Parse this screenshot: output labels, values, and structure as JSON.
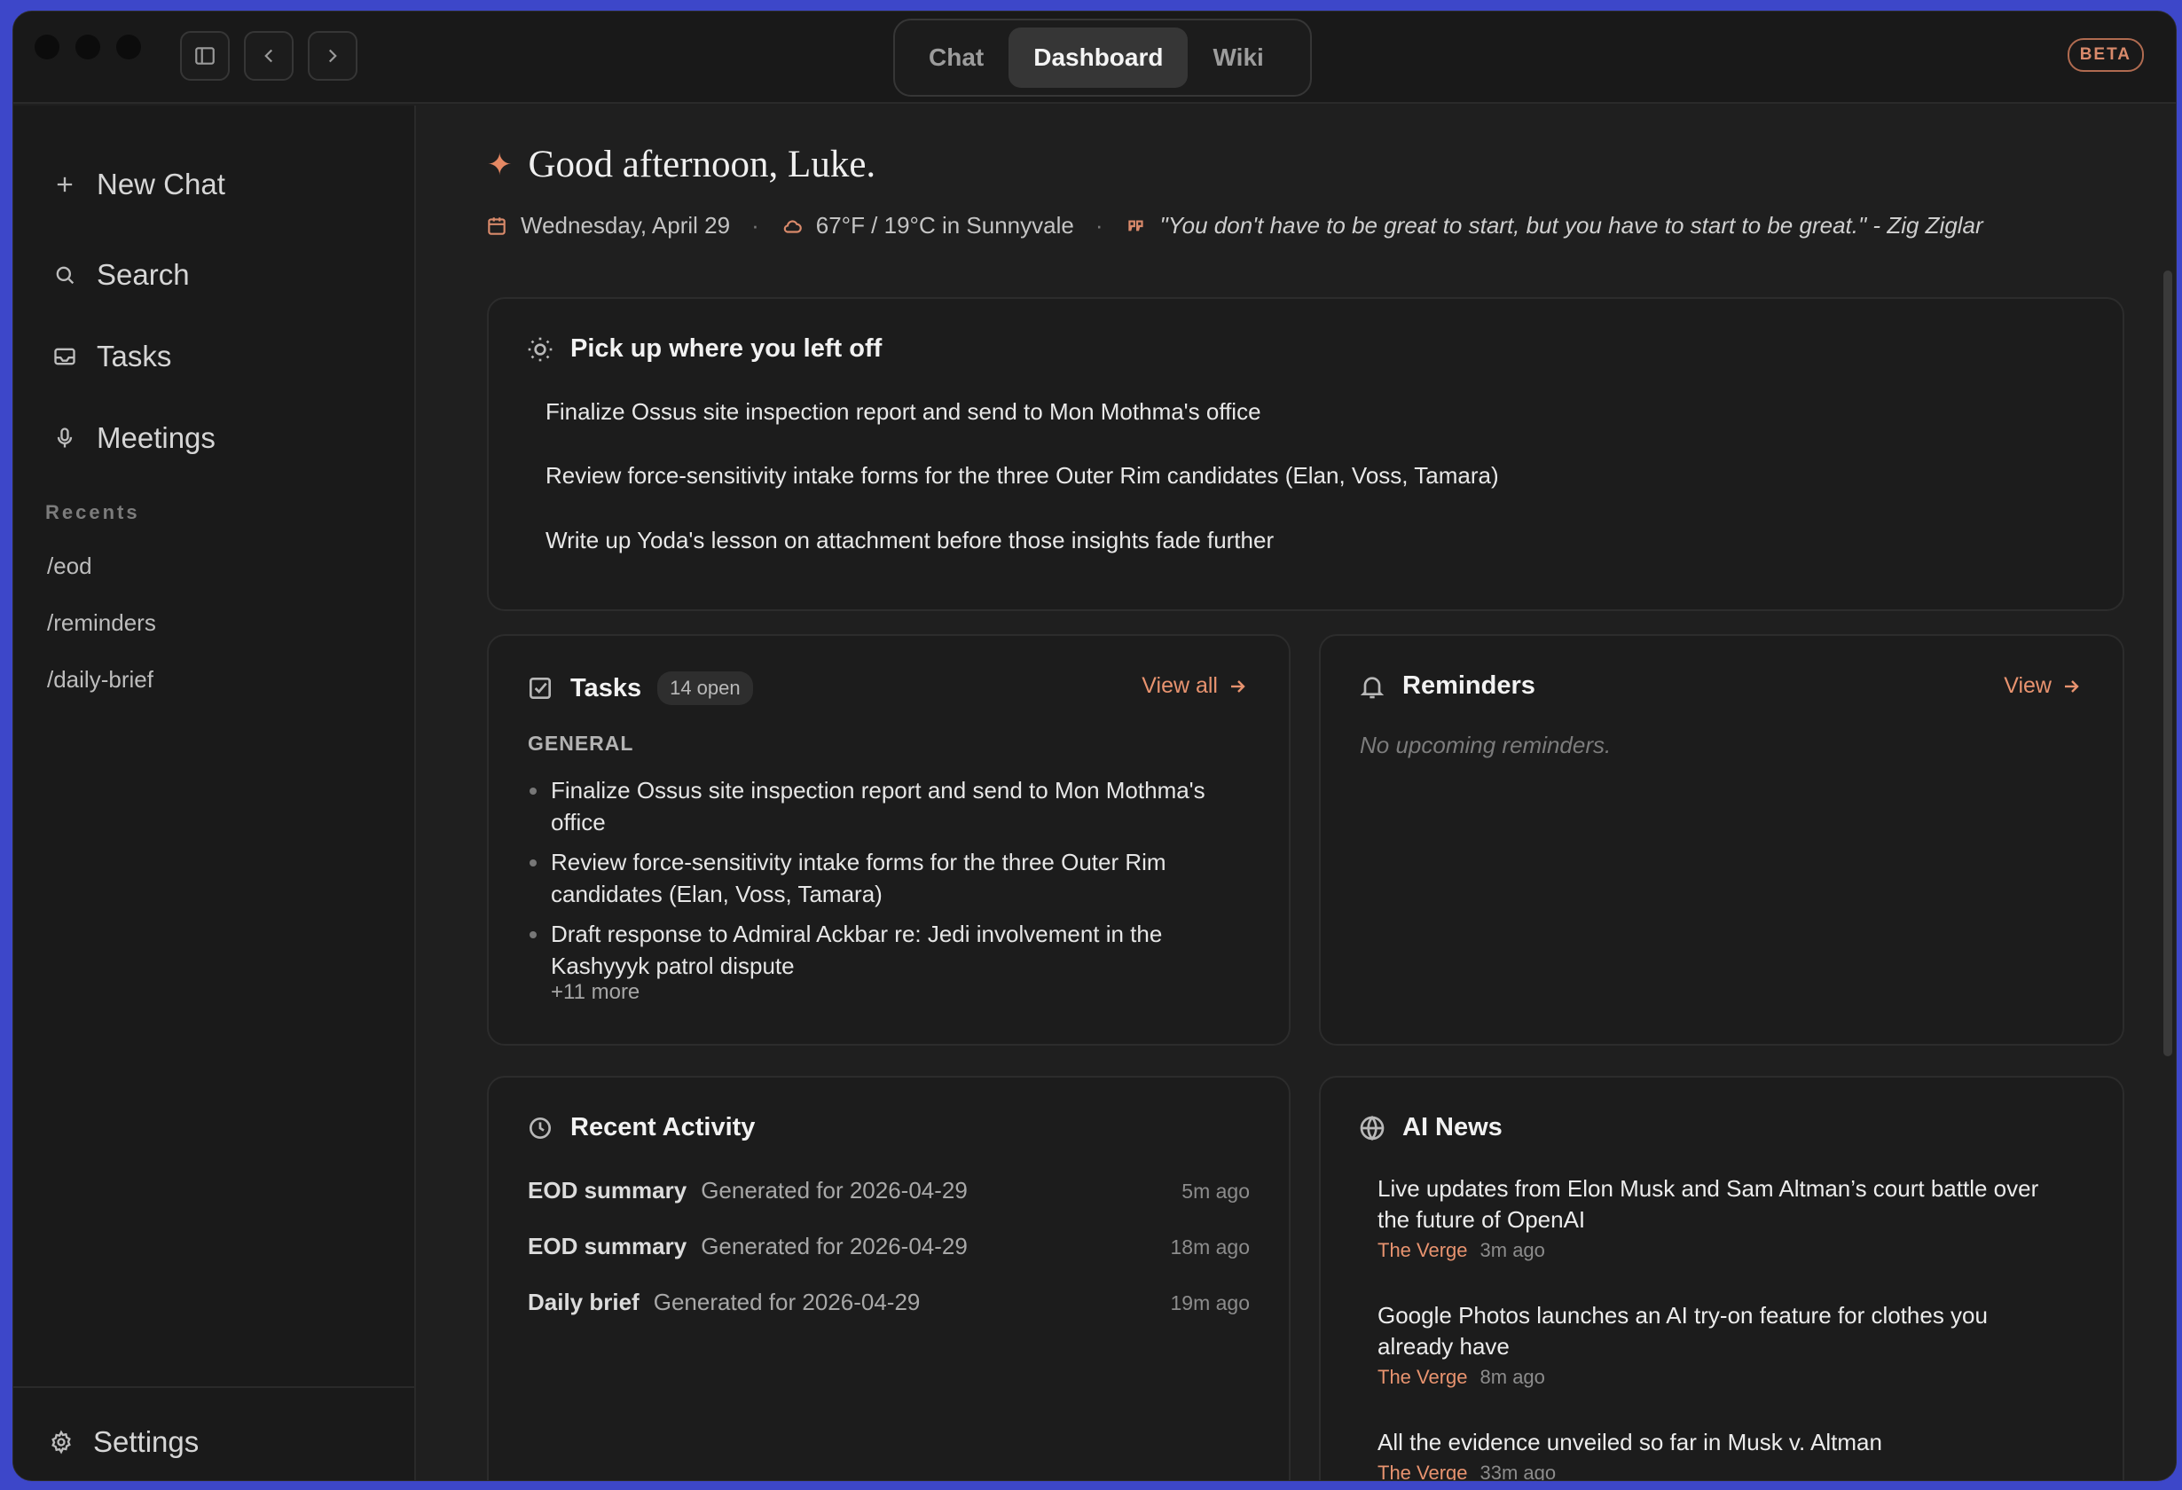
{
  "tabs": [
    {
      "label": "Chat"
    },
    {
      "label": "Dashboard"
    },
    {
      "label": "Wiki"
    }
  ],
  "beta_label": "BETA",
  "sidebar": {
    "new_chat": "New Chat",
    "search": "Search",
    "tasks": "Tasks",
    "meetings": "Meetings",
    "recents_heading": "Recents",
    "recents": [
      "/eod",
      "/reminders",
      "/daily-brief"
    ],
    "settings": "Settings"
  },
  "greeting": {
    "text": "Good afternoon, Luke.",
    "date": "Wednesday, April 29",
    "weather": "67°F / 19°C in Sunnyvale",
    "quote": "\"You don't have to be great to start, but you have to start to be great.\" - Zig Ziglar"
  },
  "pickup": {
    "title": "Pick up where you left off",
    "items": [
      "Finalize Ossus site inspection report and send to Mon Mothma's office",
      "Review force-sensitivity intake forms for the three Outer Rim candidates (Elan, Voss, Tamara)",
      "Write up Yoda's lesson on attachment before those insights fade further"
    ]
  },
  "tasks_card": {
    "title": "Tasks",
    "badge": "14 open",
    "view_all": "View all",
    "section": "GENERAL",
    "items": [
      "Finalize Ossus site inspection report and send to Mon Mothma's office",
      "Review force-sensitivity intake forms for the three Outer Rim candidates (Elan, Voss, Tamara)",
      "Draft response to Admiral Ackbar re: Jedi involvement in the Kashyyyk patrol dispute"
    ],
    "more": "+11 more"
  },
  "reminders_card": {
    "title": "Reminders",
    "view": "View",
    "empty": "No upcoming reminders."
  },
  "activity_card": {
    "title": "Recent Activity",
    "rows": [
      {
        "type": "EOD summary",
        "desc": "Generated for 2026-04-29",
        "ago": "5m ago"
      },
      {
        "type": "EOD summary",
        "desc": "Generated for 2026-04-29",
        "ago": "18m ago"
      },
      {
        "type": "Daily brief",
        "desc": "Generated for 2026-04-29",
        "ago": "19m ago"
      }
    ]
  },
  "news_card": {
    "title": "AI News",
    "items": [
      {
        "headline": "Live updates from Elon Musk and Sam Altman’s court battle over the future of OpenAI",
        "source": "The Verge",
        "ago": "3m ago"
      },
      {
        "headline": "Google Photos launches an AI try-on feature for clothes you already have",
        "source": "The Verge",
        "ago": "8m ago"
      },
      {
        "headline": "All the evidence unveiled so far in Musk v. Altman",
        "source": "The Verge",
        "ago": "33m ago"
      }
    ]
  },
  "colors": {
    "accent": "#e8936f",
    "background": "#1f1f1f",
    "desktop": "#3d47c9"
  }
}
